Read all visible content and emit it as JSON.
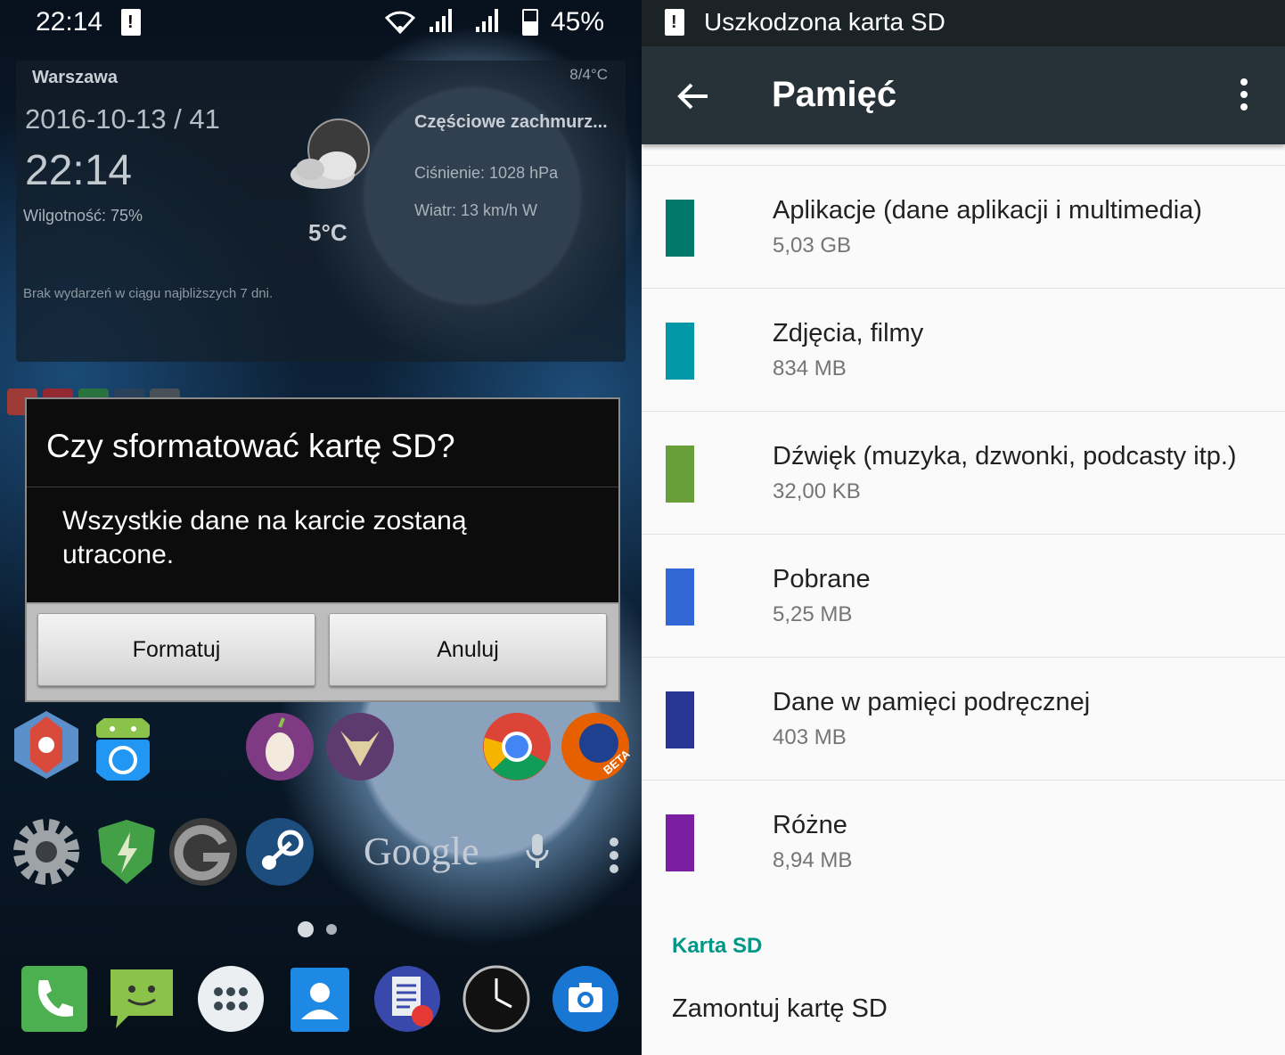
{
  "left": {
    "status_bar": {
      "time": "22:14",
      "battery": "45%"
    },
    "weather_widget": {
      "city": "Warszawa",
      "temp_range": "8/4°C",
      "date": "2016-10-13 / 41",
      "clock": "22:14",
      "humidity": "Wilgotność: 75%",
      "condition": "Częściowe zachmurz...",
      "pressure": "Ciśnienie: 1028 hPa",
      "wind": "Wiatr: 13 km/h W",
      "temperature": "5°C",
      "no_events": "Brak wydarzeń w ciągu najbliższych 7 dni."
    },
    "dialog": {
      "title": "Czy sformatować kartę SD?",
      "message": "Wszystkie dane na karcie zostaną utracone.",
      "format_button": "Formatuj",
      "cancel_button": "Anuluj"
    },
    "search_bar": {
      "google_text": "Google"
    },
    "beta_badge": "BETA"
  },
  "right": {
    "status_bar": {
      "notification": "Uszkodzona karta SD"
    },
    "toolbar": {
      "title": "Pamięć"
    },
    "storage_items": [
      {
        "title": "Aplikacje (dane aplikacji i multimedia)",
        "size": "5,03 GB",
        "color": "#00796B"
      },
      {
        "title": "Zdjęcia, filmy",
        "size": "834 MB",
        "color": "#0097A7"
      },
      {
        "title": "Dźwięk (muzyka, dzwonki, podcasty itp.)",
        "size": "32,00 KB",
        "color": "#689F38"
      },
      {
        "title": "Pobrane",
        "size": "5,25 MB",
        "color": "#3367D6"
      },
      {
        "title": "Dane w pamięci podręcznej",
        "size": "403 MB",
        "color": "#283593"
      },
      {
        "title": "Różne",
        "size": "8,94 MB",
        "color": "#7B1FA2"
      }
    ],
    "section": {
      "label": "Karta SD"
    },
    "mount_item": "Zamontuj kartę SD"
  }
}
